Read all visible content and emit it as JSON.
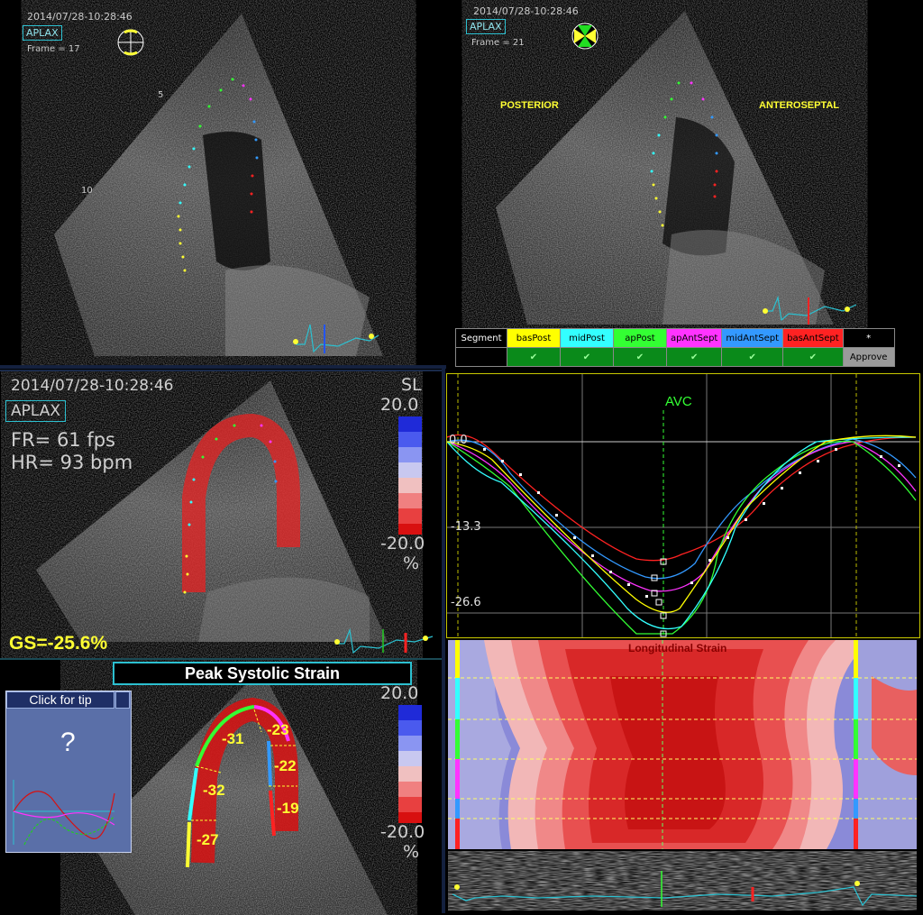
{
  "top_left": {
    "timestamp": "2014/07/28-10:28:46",
    "view": "APLAX",
    "frame": "Frame = 17",
    "depth_marks": [
      "5",
      "10"
    ]
  },
  "top_right": {
    "timestamp": "2014/07/28-10:28:46",
    "view": "APLAX",
    "frame": "Frame = 21",
    "wall_left": "POSTERIOR",
    "wall_right": "ANTEROSEPTAL",
    "segment_table": {
      "header": "Segment",
      "segments": [
        {
          "name": "basPost",
          "color": "#ffff00"
        },
        {
          "name": "midPost",
          "color": "#33ffff"
        },
        {
          "name": "apPost",
          "color": "#33ff33"
        },
        {
          "name": "apAntSept",
          "color": "#ff33ff"
        },
        {
          "name": "midAntSept",
          "color": "#3399ff"
        },
        {
          "name": "basAntSept",
          "color": "#ff2222"
        }
      ],
      "check": "✔",
      "star": "*",
      "approve": "Approve"
    }
  },
  "strain_panel": {
    "timestamp": "2014/07/28-10:28:46",
    "view": "APLAX",
    "fr": "FR= 61 fps",
    "hr": "HR= 93 bpm",
    "gs": "GS=-25.6%",
    "scale_param": "SL",
    "scale_max": "20.0",
    "scale_min": "-20.0",
    "scale_unit": "%"
  },
  "bullseye_panel": {
    "title": "Peak Systolic Strain",
    "tip_button": "Click for tip",
    "tip_icon": "?",
    "scale_max": "20.0",
    "scale_min": "-20.0",
    "scale_unit": "%",
    "segment_values": [
      "-31",
      "-23",
      "-22",
      "-32",
      "-19",
      "-27"
    ]
  },
  "strain_curves": {
    "event_label": "AVC",
    "y_ticks": [
      "0.0",
      "-13.3",
      "-26.6"
    ]
  },
  "mmode": {
    "title": "Longitudinal Strain"
  },
  "colors": {
    "accent_cyan": "#2cc0d0",
    "approve_bg": "#9a9a9a",
    "check_bg": "#0a8a1a",
    "avc_green": "#33ff33"
  }
}
